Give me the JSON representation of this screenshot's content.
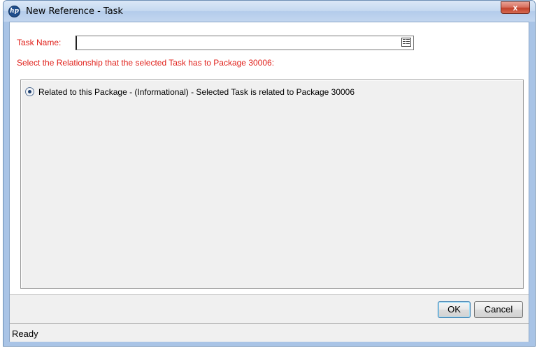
{
  "window": {
    "title": "New Reference - Task",
    "close_label": "x",
    "logo_text": "hp"
  },
  "form": {
    "task_name_label": "Task Name:",
    "task_name_value": "",
    "instruction": "Select the Relationship that the selected Task has to Package 30006:"
  },
  "relationships": [
    {
      "label": "Related to this Package - (Informational) - Selected Task is related to Package 30006",
      "selected": true
    }
  ],
  "buttons": {
    "ok_label": "OK",
    "cancel_label": "Cancel"
  },
  "status": {
    "text": "Ready"
  },
  "colors": {
    "required_label": "#e0201a",
    "title_bar": "#c4d8f0",
    "close_button": "#c2412b"
  },
  "icons": {
    "app": "hp-logo-icon",
    "lookup": "list-lookup-icon",
    "close": "close-icon"
  }
}
